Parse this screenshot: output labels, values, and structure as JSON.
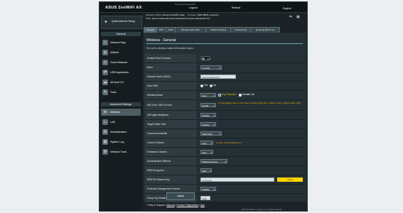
{
  "header": {
    "brand": "ASUS ZenWiFi AX",
    "powered_by": "Powered by Asuswrt-Merlin",
    "logout": "Logout",
    "reboot": "Reboot",
    "language": "English"
  },
  "info": {
    "operation_mode_label": "Operation Mode:",
    "operation_mode": "Access Point(AP) mode",
    "firmware_label": "Firmware:",
    "firmware": "3004.388.8_2-gnuton1",
    "ssid_label": "SSID:",
    "ssid": "Home NowhereTo  Home NowhereTo 5  Home NowhereTo 5-2"
  },
  "sidebar": {
    "qis_label": "Quick Internet Setup",
    "general_header": "General",
    "general_items": [
      "Network Map",
      "AiMesh",
      "Guest Network",
      "USB Application",
      "AiCloud 2.0",
      "Tools"
    ],
    "advanced_header": "Advanced Settings",
    "advanced_items": [
      "Wireless",
      "LAN",
      "Administration",
      "System Log",
      "Network Tools"
    ]
  },
  "tabs": [
    "General",
    "WPS",
    "WDS",
    "Wireless MAC Filter",
    "RADIUS Setting",
    "Professional",
    "Roaming Block List"
  ],
  "panel": {
    "title": "Wireless - General",
    "description": "Set up the wireless related information below.",
    "rows": {
      "smart_connect": {
        "label": "Enable Smart Connect",
        "value": "OFF"
      },
      "band": {
        "label": "Band",
        "value": "2.4 GHz"
      },
      "ssid": {
        "label": "Network Name (SSID)",
        "value": "Home NowhereTo"
      },
      "hide_ssid": {
        "label": "Hide SSID",
        "yes": "Yes",
        "no": "No"
      },
      "wireless_mode": {
        "label": "Wireless Mode",
        "value": "Auto",
        "opt1": "b/g Protection",
        "opt2": "Disable 11b"
      },
      "ax_mode": {
        "label": "802.11ax / WiFi 6 mode",
        "value": "Enable",
        "note": "If compatibility issue occurs when enabling 802.11ax / WiFi 6 mode, please check: FAQ"
      },
      "agile": {
        "label": "WiFi Agile Multiband",
        "value": "Disable"
      },
      "twt": {
        "label": "Target Wake Time",
        "value": "Disable"
      },
      "bandwidth": {
        "label": "Channel bandwidth",
        "value": "20/40 MHz"
      },
      "control_channel": {
        "label": "Control Channel",
        "value": "Auto",
        "note": "Current Control Channel: 5"
      },
      "extension_channel": {
        "label": "Extension Channel",
        "value": "Auto"
      },
      "auth": {
        "label": "Authentication Method",
        "value": "WPA2-Personal"
      },
      "encryption": {
        "label": "WPA Encryption",
        "value": "AES"
      },
      "psk": {
        "label": "WPA Pre-Shared Key",
        "value": "•••••••••••••",
        "strength": "Good"
      },
      "pmf": {
        "label": "Protected Management Frames",
        "value": "Disable"
      },
      "rotation": {
        "label": "Group Key Rotation Interval",
        "value": "3600"
      }
    },
    "apply": "Apply"
  },
  "footer": {
    "help": "Help & Support",
    "manual": "Manual",
    "product_reg": "Product Registration",
    "app": "App",
    "copyright": "2023 ASUSTeK Computer Inc. All rights reserved."
  }
}
